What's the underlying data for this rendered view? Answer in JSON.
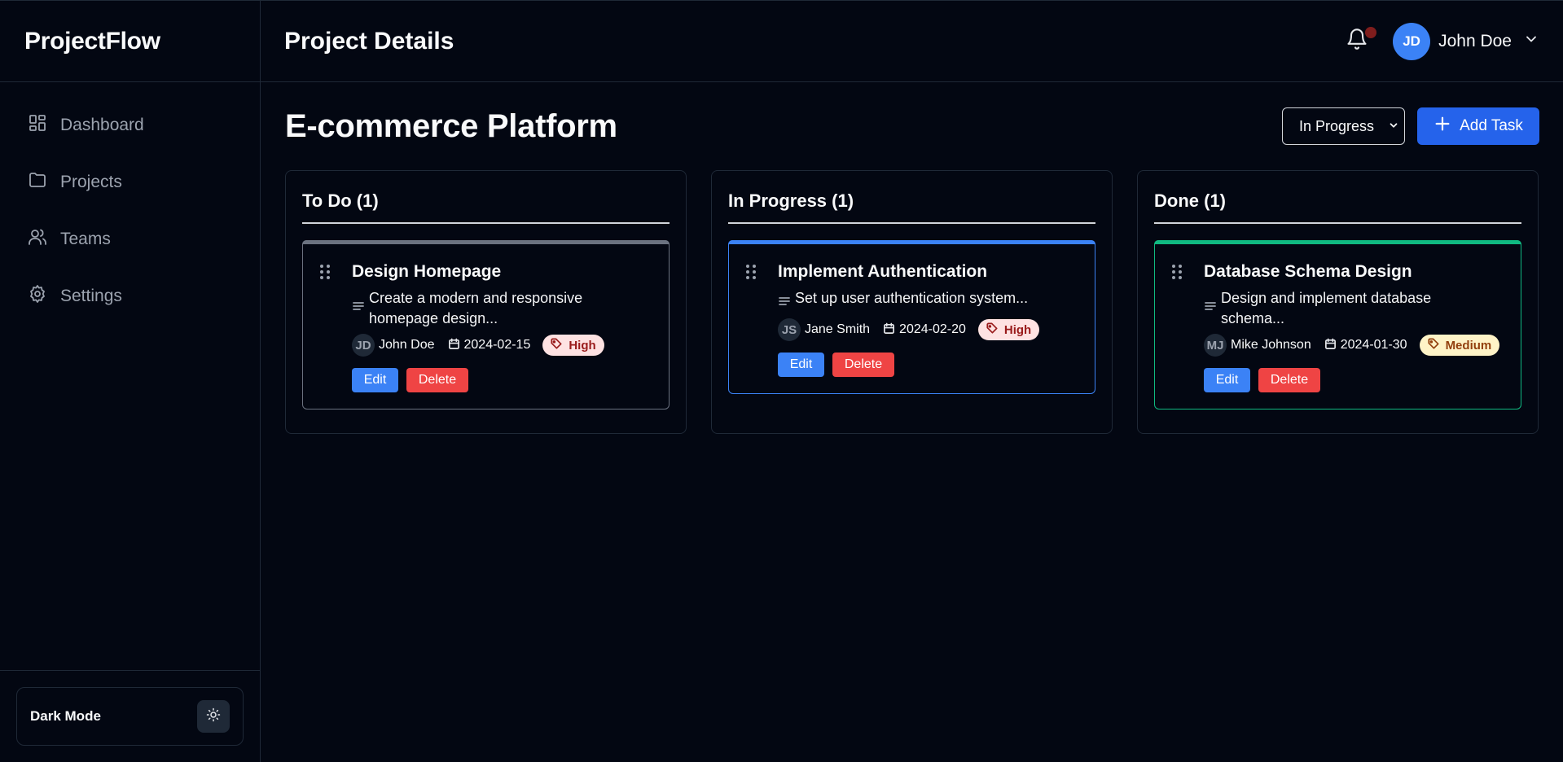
{
  "app": {
    "brand": "ProjectFlow",
    "page_title": "Project Details"
  },
  "sidebar": {
    "items": [
      {
        "label": "Dashboard",
        "icon": "dashboard-icon"
      },
      {
        "label": "Projects",
        "icon": "folder-icon"
      },
      {
        "label": "Teams",
        "icon": "users-icon"
      },
      {
        "label": "Settings",
        "icon": "gear-icon"
      }
    ],
    "footer": {
      "label": "Dark Mode",
      "icon": "sun-icon"
    }
  },
  "header": {
    "user": {
      "initials": "JD",
      "name": "John Doe"
    },
    "notification_dot_color": "#7f1d1d"
  },
  "project": {
    "title": "E-commerce Platform",
    "status_select": {
      "value": "In Progress"
    },
    "add_task_label": "Add Task"
  },
  "colors": {
    "todo": "#6b7280",
    "in_progress": "#3b82f6",
    "done": "#10b981",
    "primary": "#2563eb",
    "danger": "#ef4444"
  },
  "columns": [
    {
      "title": "To Do (1)",
      "tasks": [
        {
          "title": "Design Homepage",
          "description": "Create a modern and responsive homepage design...",
          "assignee_initials": "JD",
          "assignee": "John Doe",
          "due": "2024-02-15",
          "priority": "High",
          "edit": "Edit",
          "delete": "Delete"
        }
      ]
    },
    {
      "title": "In Progress (1)",
      "tasks": [
        {
          "title": "Implement Authentication",
          "description": "Set up user authentication system...",
          "assignee_initials": "JS",
          "assignee": "Jane Smith",
          "due": "2024-02-20",
          "priority": "High",
          "edit": "Edit",
          "delete": "Delete"
        }
      ]
    },
    {
      "title": "Done (1)",
      "tasks": [
        {
          "title": "Database Schema Design",
          "description": "Design and implement database schema...",
          "assignee_initials": "MJ",
          "assignee": "Mike Johnson",
          "due": "2024-01-30",
          "priority": "Medium",
          "edit": "Edit",
          "delete": "Delete"
        }
      ]
    }
  ]
}
